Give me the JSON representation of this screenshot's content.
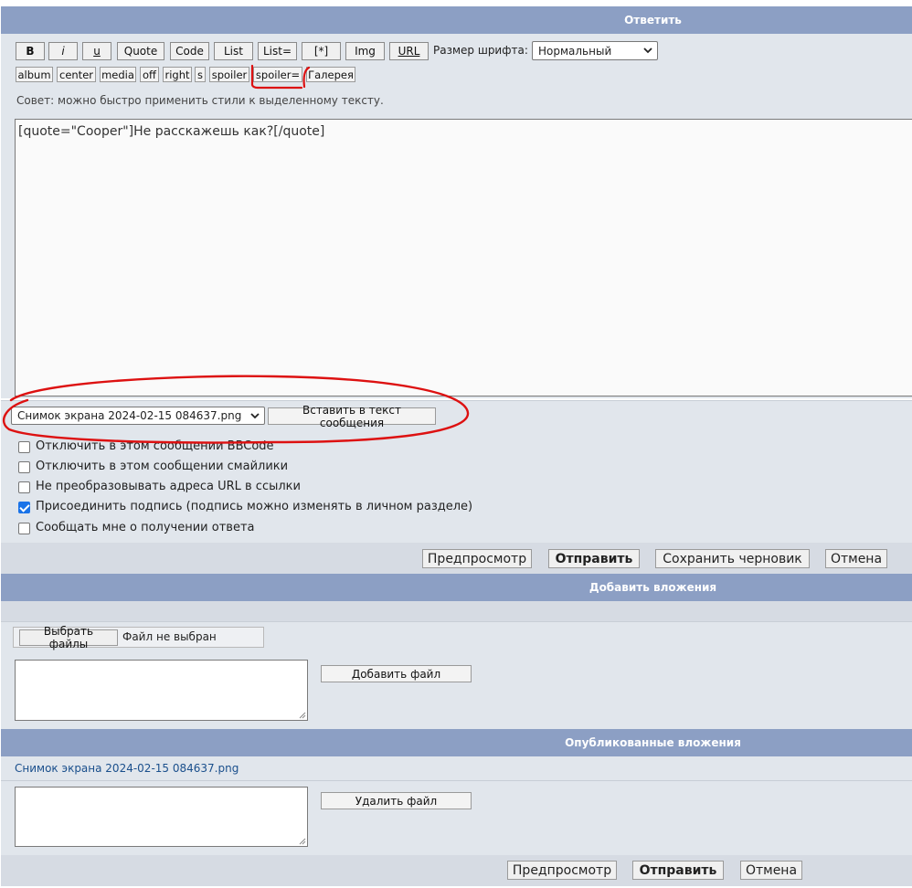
{
  "reply": {
    "header": "Ответить",
    "toolbar": {
      "row1": [
        "B",
        "i",
        "u",
        "Quote",
        "Code",
        "List",
        "List=",
        "[*]",
        "Img",
        "URL"
      ],
      "font_size_label": "Размер шрифта:",
      "font_size_value": "Нормальный",
      "row2": [
        "album",
        "center",
        "media",
        "off",
        "right",
        "s",
        "spoiler",
        "spoiler=",
        "Галерея"
      ]
    },
    "tip": "Совет: можно быстро применить стили к выделенному тексту.",
    "message": "[quote=\"Cooper\"]Не расскажешь как?[/quote]",
    "attachment_select": "Снимок экрана 2024-02-15 084637.png",
    "insert_button": "Вставить в текст сообщения",
    "options": [
      {
        "label": "Отключить в этом сообщении BBCode",
        "checked": false
      },
      {
        "label": "Отключить в этом сообщении смайлики",
        "checked": false
      },
      {
        "label": "Не преобразовывать адреса URL в ссылки",
        "checked": false
      },
      {
        "label": "Присоединить подпись (подпись можно изменять в личном разделе)",
        "checked": true
      },
      {
        "label": "Сообщать мне о получении ответа",
        "checked": false
      }
    ],
    "actions": {
      "preview": "Предпросмотр",
      "submit": "Отправить",
      "save_draft": "Сохранить черновик",
      "cancel": "Отмена"
    }
  },
  "add_attachments": {
    "header": "Добавить вложения",
    "choose_files": "Выбрать файлы",
    "no_file": "Файл не выбран",
    "add_file": "Добавить файл"
  },
  "posted_attachments": {
    "header": "Опубликованные вложения",
    "file_name": "Снимок экрана 2024-02-15 084637.png",
    "delete_file": "Удалить файл"
  },
  "bottom_actions": {
    "preview": "Предпросмотр",
    "submit": "Отправить",
    "cancel": "Отмена"
  },
  "colors": {
    "header": "#8c9fc4",
    "row": "#e1e6ec",
    "annotation": "#dd1111",
    "link": "#1a4f8c",
    "checkbox": "#1a73e8"
  }
}
